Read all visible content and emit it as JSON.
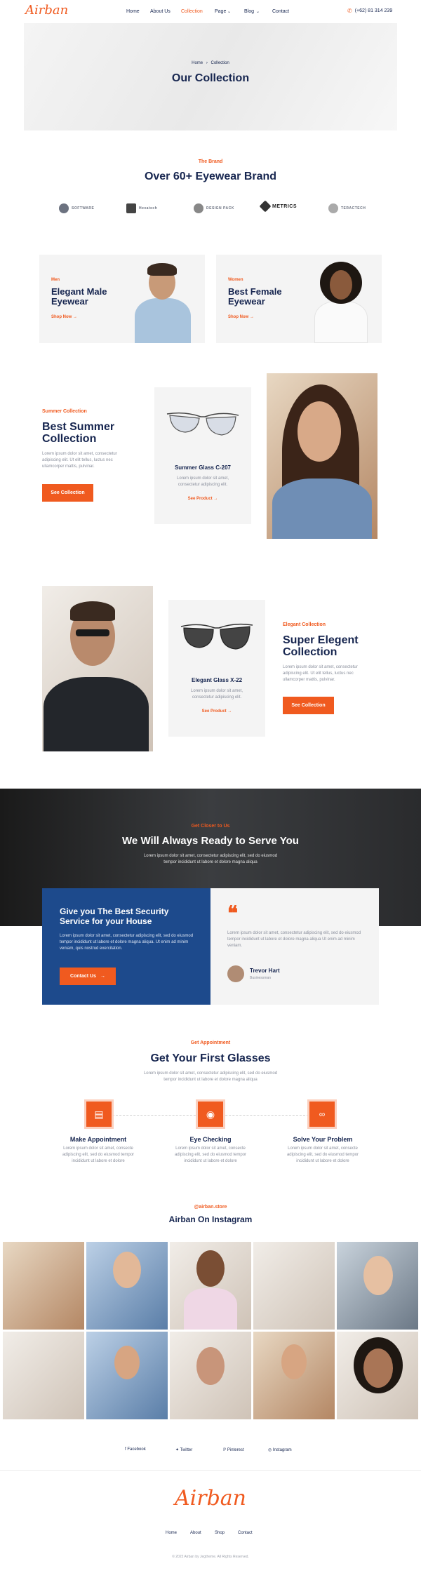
{
  "header": {
    "logo": "Airban",
    "nav": [
      "Home",
      "About Us",
      "Collection",
      "Page",
      "Blog",
      "Contact"
    ],
    "active": "Collection",
    "phone": "(+62) 81 314 239"
  },
  "hero": {
    "breadcrumb_home": "Home",
    "breadcrumb_current": "Collection",
    "title": "Our Collection"
  },
  "brand": {
    "eyebrow": "The Brand",
    "title": "Over 60+ Eyewear Brand",
    "logos": [
      "SOFTWARE",
      "Hexatech",
      "DESIGN PACK",
      "METRICS",
      "TERACTECH"
    ]
  },
  "promo": [
    {
      "eyebrow": "Men",
      "title_line1": "Elegant Male",
      "title_line2": "Eyewear",
      "link": "Shop Now"
    },
    {
      "eyebrow": "Women",
      "title_line1": "Best Female",
      "title_line2": "Eyewear",
      "link": "Shop Now"
    }
  ],
  "summer": {
    "eyebrow": "Summer Collection",
    "title_line1": "Best Summer",
    "title_line2": "Collection",
    "text": "Lorem ipsum dolor sit amet, consectetur adipiscing elit. Ut elit tellus, luctus nec ullamcorper mattis, pulvinar.",
    "button": "See Collection",
    "product": {
      "name": "Summer Glass C-207",
      "text": "Lorem ipsum dolor sit amet, consectetur adipiscing elit.",
      "link": "See Product"
    }
  },
  "elegant": {
    "eyebrow": "Elegant Collection",
    "title_line1": "Super Elegent",
    "title_line2": "Collection",
    "text": "Lorem ipsum dolor sit amet, consectetur adipiscing elit. Ut elit tellus, luctus nec ullamcorper mattis, pulvinar.",
    "button": "See Collection",
    "product": {
      "name": "Elegant Glass X-22",
      "text": "Lorem ipsum dolor sit amet, consectetur adipiscing elit.",
      "link": "See Product"
    }
  },
  "serve": {
    "eyebrow": "Get Closer to Us",
    "title": "We Will Always Ready to Serve You",
    "text_line1": "Lorem ipsum dolor sit amet, consectetur adipiscing elit, sed do eiusmod",
    "text_line2": "tempor incididunt ut labore et dolore magna aliqua"
  },
  "security": {
    "title_line1": "Give you The Best Security",
    "title_line2": "Service for your House",
    "text": "Lorem ipsum dolor sit amet, consectetur adipiscing elit, sed do eiusmod tempor incididunt ut labore et dolore magna aliqua. Ut enim ad minim veniam, quis nostrud exercitation.",
    "button": "Contact Us"
  },
  "testimonial": {
    "text": "Lorem ipsum dolor sit amet, consectetur adipiscing elit, sed do eiusmod tempor incididunt ut labore et dolore magna aliqua Ut enim ad minim veniam.",
    "name": "Trevor Hart",
    "role": "Businessman"
  },
  "appointment": {
    "eyebrow": "Get Appointment",
    "title": "Get Your First Glasses",
    "text_line1": "Lorem ipsum dolor sit amet, consectetur adipiscing elit, sed do eiusmod",
    "text_line2": "tempor incididunt ut labore et dolore magna aliqua",
    "steps": [
      {
        "title": "Make Appointment",
        "text": "Lorem ipsum dolor sit amet, consecte adipiscing elit, sed do eiusmod tempor incididunt ut labore et dolore"
      },
      {
        "title": "Eye Checking",
        "text": "Lorem ipsum dolor sit amet, consecte adipiscing elit, sed do eiusmod tempor incididunt ut labore et dolore"
      },
      {
        "title": "Solve Your Problem",
        "text": "Lorem ipsum dolor sit amet, consecte adipiscing elit, sed do eiusmod tempor incididunt ut labore et dolore"
      }
    ]
  },
  "instagram": {
    "handle": "@airban.store",
    "title": "Airban On Instagram"
  },
  "social": [
    "Facebook",
    "Twitter",
    "Pinterest",
    "Instagram"
  ],
  "footer": {
    "logo": "Airban",
    "links": [
      "Home",
      "About",
      "Shop",
      "Contact"
    ],
    "copyright": "© 2022 Airban by Jegtheme. All Rights Reserved."
  },
  "colors": {
    "accent": "#f05a1f",
    "navy": "#16254f",
    "panel": "#f4f4f4",
    "security_blue": "#1d4a8c"
  }
}
